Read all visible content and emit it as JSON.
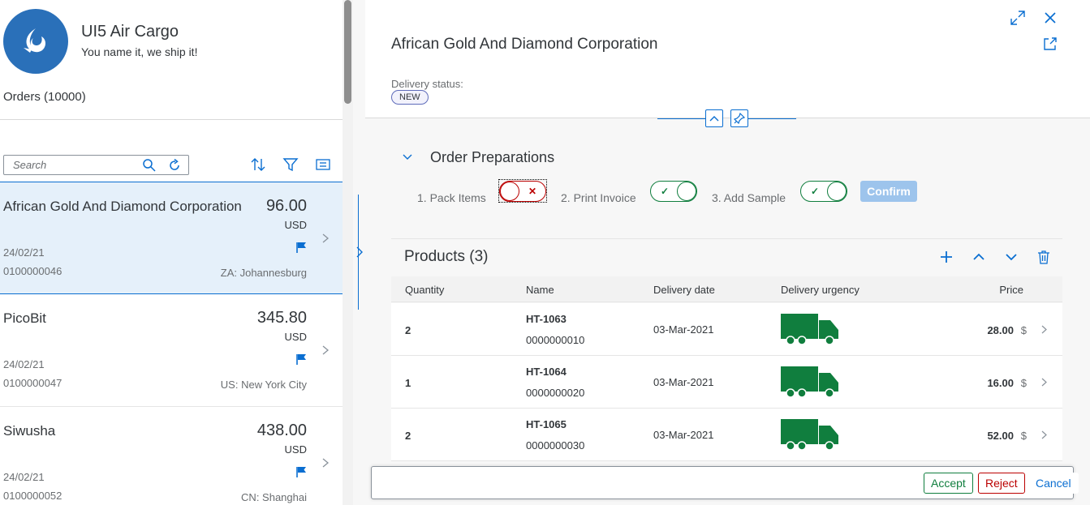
{
  "app": {
    "title": "UI5 Air Cargo",
    "subtitle": "You name it, we ship it!",
    "orders_count": "Orders (10000)",
    "logo_icon": "bird-logo-icon"
  },
  "search": {
    "placeholder": "Search",
    "value": ""
  },
  "toolbar": {
    "icons": [
      "sort-icon",
      "filter-icon",
      "group-icon"
    ]
  },
  "orders": [
    {
      "name": "African Gold And Diamond Corporation",
      "amount": "96.00",
      "currency": "USD",
      "date": "24/02/21",
      "order_number": "0100000046",
      "city": "ZA: Johannesburg",
      "selected": true
    },
    {
      "name": "PicoBit",
      "amount": "345.80",
      "currency": "USD",
      "date": "24/02/21",
      "order_number": "0100000047",
      "city": "US: New York City",
      "selected": false
    },
    {
      "name": "Siwusha",
      "amount": "438.00",
      "currency": "USD",
      "date": "24/02/21",
      "order_number": "0100000052",
      "city": "CN: Shanghai",
      "selected": false
    }
  ],
  "detail": {
    "title": "African Gold And Diamond Corporation",
    "status_label": "Delivery status:",
    "status_value": "NEW",
    "section_title": "Order Preparations",
    "steps": [
      {
        "label": "1. Pack Items",
        "done": false
      },
      {
        "label": "2. Print Invoice",
        "done": true
      },
      {
        "label": "3. Add Sample",
        "done": true
      }
    ],
    "confirm_label": "Confirm"
  },
  "products": {
    "title": "Products (3)",
    "columns": [
      "Quantity",
      "Name",
      "Delivery date",
      "Delivery urgency",
      "Price"
    ],
    "rows": [
      {
        "quantity": "2",
        "name": "HT-1063",
        "id": "0000000010",
        "delivery_date": "03-Mar-2021",
        "price": "28.00",
        "currency": "$"
      },
      {
        "quantity": "1",
        "name": "HT-1064",
        "id": "0000000020",
        "delivery_date": "03-Mar-2021",
        "price": "16.00",
        "currency": "$"
      },
      {
        "quantity": "2",
        "name": "HT-1065",
        "id": "0000000030",
        "delivery_date": "03-Mar-2021",
        "price": "52.00",
        "currency": "$"
      }
    ]
  },
  "footer": {
    "accept": "Accept",
    "reject": "Reject",
    "cancel": "Cancel"
  },
  "colors": {
    "accent": "#0a6ed1",
    "positive": "#107e3e",
    "negative": "#bb0000",
    "selected_bg": "#e5f0fa"
  }
}
